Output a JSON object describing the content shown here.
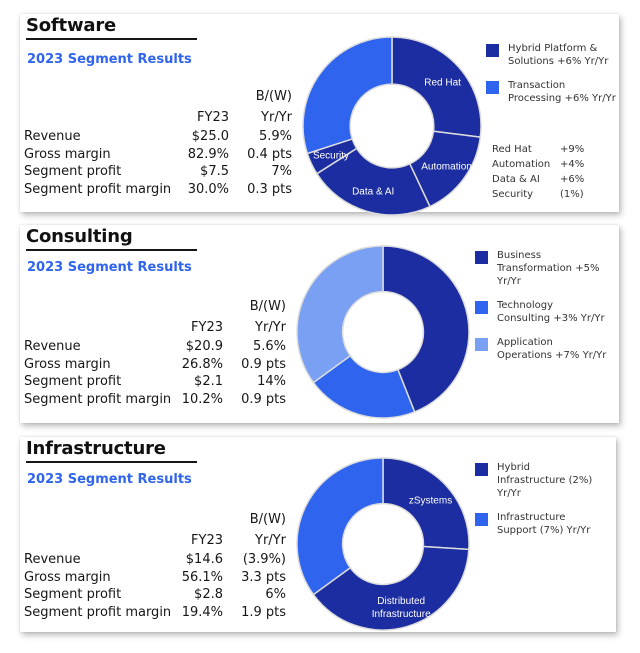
{
  "colors": {
    "dark": "#1b2da0",
    "medium": "#2f64ef",
    "light": "#7aa0f4",
    "subtitle": "#2f64ef"
  },
  "columns": {
    "fy": "FY23",
    "bw_line1": "B/(W)",
    "bw_line2": "Yr/Yr"
  },
  "panels": [
    {
      "title": "Software",
      "subtitle": "2023 Segment Results",
      "rows": [
        {
          "label": "Revenue",
          "fy23": "$25.0",
          "yoy": "5.9%"
        },
        {
          "label": "Gross margin",
          "fy23": "82.9%",
          "yoy": "0.4 pts"
        },
        {
          "label": "Segment profit",
          "fy23": "$7.5",
          "yoy": "7%"
        },
        {
          "label": "Segment profit margin",
          "fy23": "30.0%",
          "yoy": "0.3 pts"
        }
      ],
      "legend": [
        {
          "line1": "Hybrid Platform &",
          "line2": "Solutions +6% Yr/Yr",
          "color": "#1b2da0"
        },
        {
          "line1": "Transaction",
          "line2": "Processing +6% Yr/Yr",
          "color": "#2f64ef"
        }
      ],
      "growth": [
        {
          "name": "Red Hat",
          "value": "+9%"
        },
        {
          "name": "Automation",
          "value": "+4%"
        },
        {
          "name": "Data & AI",
          "value": "+6%"
        },
        {
          "name": "Security",
          "value": "(1%)"
        }
      ]
    },
    {
      "title": "Consulting",
      "subtitle": "2023 Segment Results",
      "rows": [
        {
          "label": "Revenue",
          "fy23": "$20.9",
          "yoy": "5.6%"
        },
        {
          "label": "Gross margin",
          "fy23": "26.8%",
          "yoy": "0.9 pts"
        },
        {
          "label": "Segment profit",
          "fy23": "$2.1",
          "yoy": "14%"
        },
        {
          "label": "Segment profit margin",
          "fy23": "10.2%",
          "yoy": "0.9 pts"
        }
      ],
      "legend": [
        {
          "line1": "Business",
          "line2": "Transformation +5% Yr/Yr",
          "color": "#1b2da0"
        },
        {
          "line1": "Technology",
          "line2": "Consulting +3% Yr/Yr",
          "color": "#2f64ef"
        },
        {
          "line1": "Application",
          "line2": "Operations +7% Yr/Yr",
          "color": "#7aa0f4"
        }
      ]
    },
    {
      "title": "Infrastructure",
      "subtitle": "2023 Segment Results",
      "rows": [
        {
          "label": "Revenue",
          "fy23": "$14.6",
          "yoy": "(3.9%)"
        },
        {
          "label": "Gross margin",
          "fy23": "56.1%",
          "yoy": "3.3 pts"
        },
        {
          "label": "Segment profit",
          "fy23": "$2.8",
          "yoy": "6%"
        },
        {
          "label": "Segment profit margin",
          "fy23": "19.4%",
          "yoy": "1.9 pts"
        }
      ],
      "legend": [
        {
          "line1": "Hybrid",
          "line2": "Infrastructure (2%) Yr/Yr",
          "color": "#1b2da0"
        },
        {
          "line1": "Infrastructure",
          "line2": "Support (7%) Yr/Yr",
          "color": "#2f64ef"
        }
      ]
    }
  ],
  "chart_data": [
    {
      "type": "pie",
      "title": "Software",
      "donut": true,
      "start": "top, clockwise",
      "slices": [
        {
          "name": "Red Hat",
          "share": 27,
          "label": "Red Hat",
          "color": "#1b2da0"
        },
        {
          "name": "Automation",
          "share": 16,
          "label": "Automation",
          "color": "#1b2da0"
        },
        {
          "name": "Data & AI",
          "share": 23,
          "label": "Data & AI",
          "color": "#1b2da0"
        },
        {
          "name": "Security",
          "share": 4,
          "label": "Security",
          "color": "#1b2da0"
        },
        {
          "name": "Transaction Processing",
          "share": 30,
          "label": "",
          "color": "#2f64ef"
        }
      ]
    },
    {
      "type": "pie",
      "title": "Consulting",
      "donut": true,
      "start": "top, clockwise",
      "slices": [
        {
          "name": "Business Transformation",
          "share": 44,
          "label": "",
          "color": "#1b2da0"
        },
        {
          "name": "Technology Consulting",
          "share": 21,
          "label": "",
          "color": "#2f64ef"
        },
        {
          "name": "Application Operations",
          "share": 35,
          "label": "",
          "color": "#7aa0f4"
        }
      ]
    },
    {
      "type": "pie",
      "title": "Infrastructure",
      "donut": true,
      "start": "top, clockwise",
      "slices": [
        {
          "name": "zSystems",
          "share": 26,
          "label": "zSystems",
          "color": "#1b2da0"
        },
        {
          "name": "Distributed Infrastructure",
          "share": 39,
          "label": "Distributed|Infrastructure",
          "color": "#1b2da0"
        },
        {
          "name": "Infrastructure Support",
          "share": 35,
          "label": "",
          "color": "#2f64ef"
        }
      ]
    }
  ]
}
